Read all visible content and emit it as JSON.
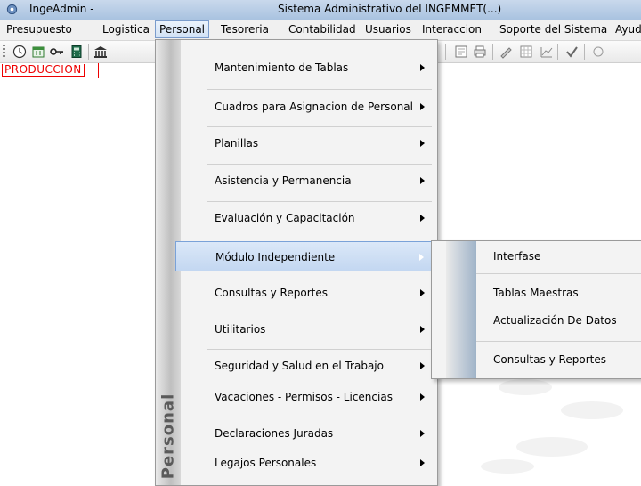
{
  "window": {
    "app_name": "IngeAdmin -",
    "title": "Sistema Administrativo del INGEMMET(...)"
  },
  "menubar": {
    "items": [
      "Presupuesto",
      "Logistica",
      "Personal",
      "Tesoreria",
      "Contabilidad",
      "Usuarios",
      "Interaccion",
      "Soporte del Sistema",
      "Ayuda"
    ],
    "active": "Personal"
  },
  "content": {
    "environment_label": "PRODUCCION"
  },
  "personal_menu": {
    "band_label": "Personal",
    "items": [
      "Mantenimiento de Tablas",
      "Cuadros para Asignacion de Personal",
      "Planillas",
      "Asistencia y Permanencia",
      "Evaluación y Capacitación",
      "Módulo Independiente",
      "Consultas y Reportes",
      "Utilitarios",
      "Seguridad y Salud en el Trabajo",
      "Vacaciones - Permisos - Licencias",
      "Declaraciones Juradas",
      "Legajos Personales"
    ],
    "highlighted": "Módulo Independiente"
  },
  "submenu": {
    "items": [
      "Interfase",
      "Tablas Maestras",
      "Actualización De Datos",
      "Consultas y Reportes"
    ]
  },
  "toolbar": {
    "icons": [
      "clock-icon",
      "calendar-icon",
      "key-icon",
      "calculator-icon",
      "bank-icon",
      "preview-icon",
      "print-icon",
      "pen-icon",
      "grid-icon",
      "chart-icon",
      "check-icon",
      "more-icon"
    ]
  },
  "colors": {
    "highlight": "#c3d7f1",
    "environment_red": "#e00000",
    "titlebar": "#a9c3e0"
  }
}
